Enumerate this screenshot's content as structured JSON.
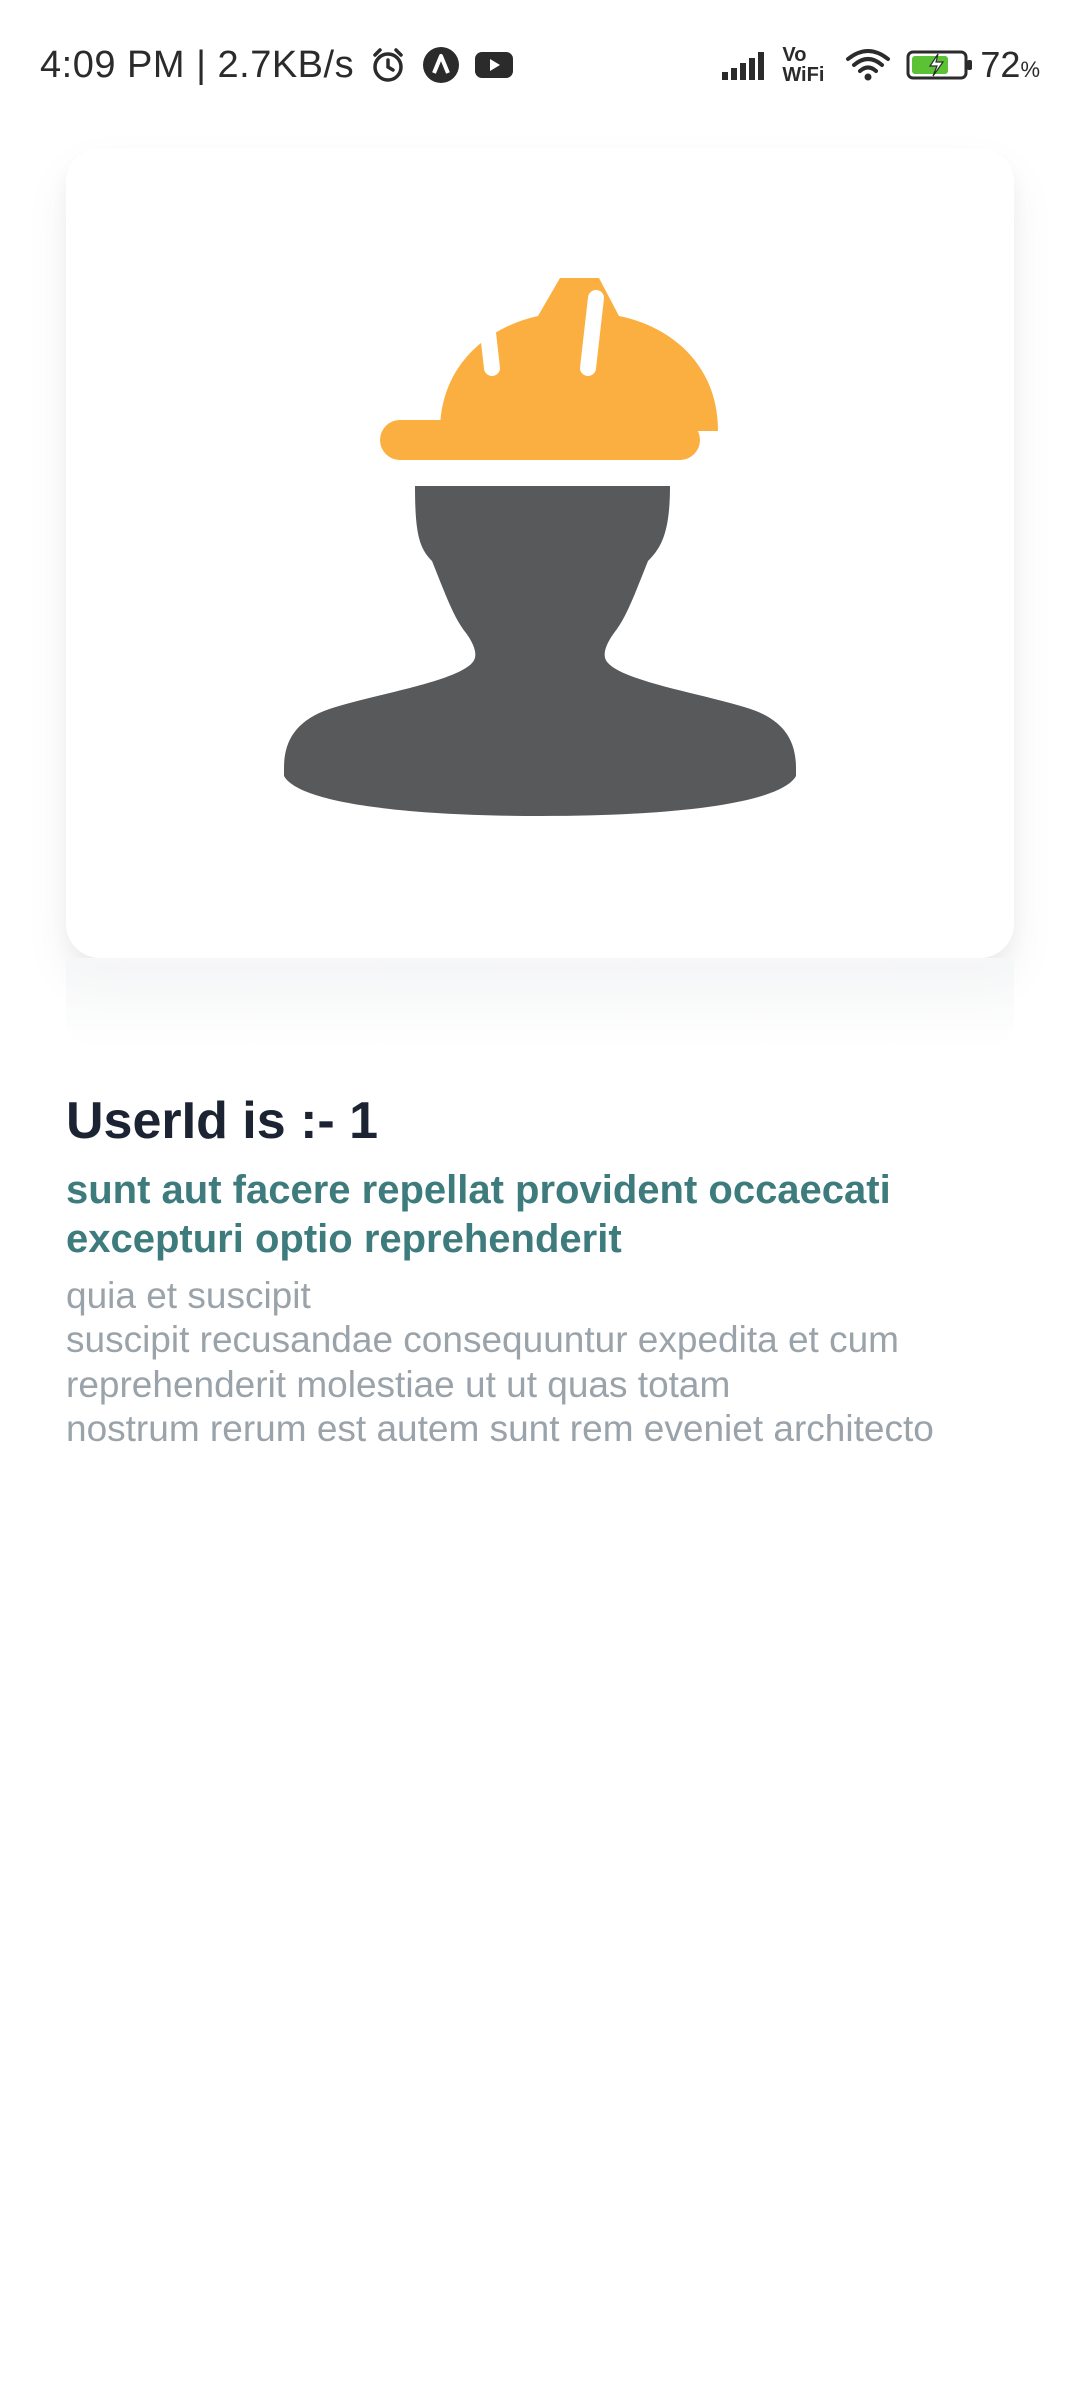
{
  "status_bar": {
    "time_speed": "4:09 PM | 2.7KB/s",
    "vo_top": "Vo",
    "vo_bottom": "WiFi",
    "battery_percent": "72",
    "battery_percent_suffix": "%",
    "icons": [
      "alarm-icon",
      "app-a-icon",
      "youtube-icon",
      "signal-icon",
      "wifi-icon",
      "battery-charging-icon"
    ]
  },
  "post": {
    "userid_label": "UserId is :- 1",
    "title": "sunt aut facere repellat provident occaecati excepturi optio reprehenderit",
    "body": "quia et suscipit\nsuscipit recusandae consequuntur expedita et cum reprehenderit molestiae ut ut quas totam\nnostrum rerum est autem sunt rem eveniet architecto"
  },
  "colors": {
    "helmet": "#FAAF40",
    "silhouette": "#58595B",
    "title": "#3D7B7D",
    "body": "#9AA3AA",
    "heading": "#1C2433"
  }
}
